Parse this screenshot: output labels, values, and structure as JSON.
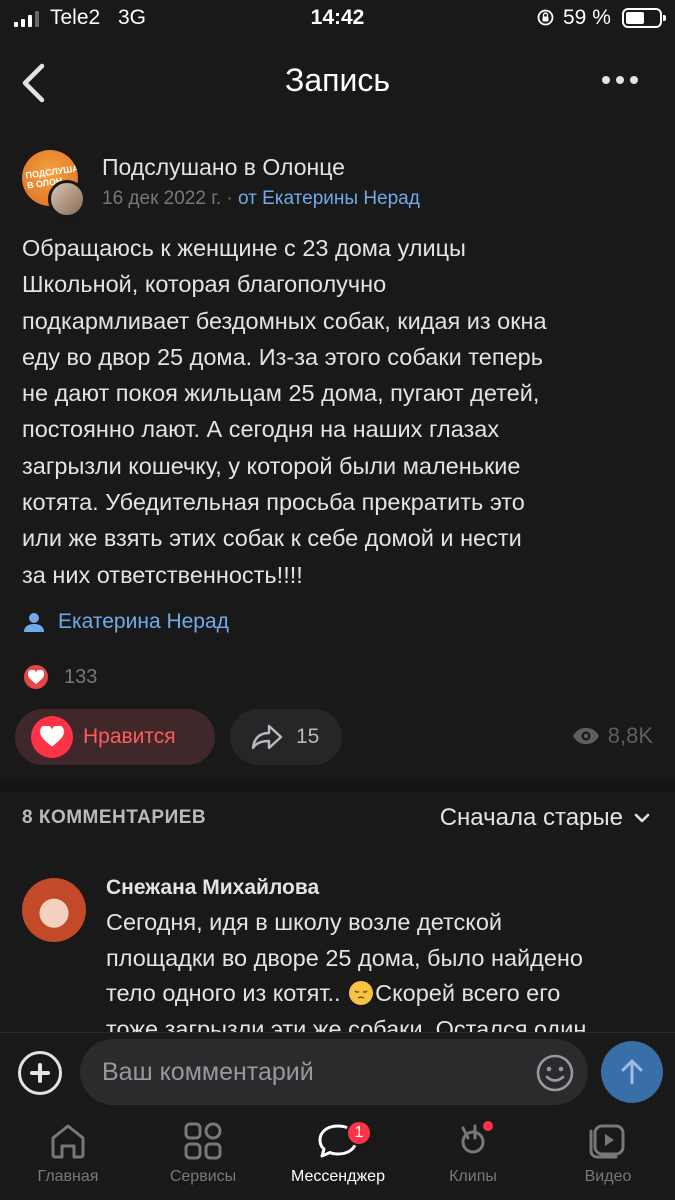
{
  "status_bar": {
    "carrier": "Tele2",
    "network": "3G",
    "time": "14:42",
    "battery_percent": "59 %",
    "battery_level": 0.59
  },
  "header": {
    "title": "Запись"
  },
  "post": {
    "group_name": "Подслушано в Олонце",
    "date": "16 дек 2022 г.",
    "separator": "·",
    "from_label": "от Екатерины Нерад",
    "text_lines": [
      "Обращаюсь к женщине с 23 дома улицы",
      "Школьной, которая благополучно",
      "подкармливает бездомных собак, кидая из окна",
      "еду во двор 25 дома. Из-за этого собаки теперь",
      "не дают покоя жильцам 25 дома, пугают детей,",
      "постоянно лают. А сегодня на наших глазах",
      "загрызли кошечку, у которой были маленькие",
      "котята. Убедительная просьба прекратить это",
      "или же взять этих собак к себе домой и нести",
      "за них ответственность!!!!"
    ],
    "signer": "Екатерина Нерад",
    "likes_count": "133",
    "like_button_label": "Нравится",
    "shares_count": "15",
    "views": "8,8K"
  },
  "comments": {
    "count_label": "8 КОММЕНТАРИЕВ",
    "sort_label": "Сначала старые",
    "items": [
      {
        "author": "Снежана Михайлова",
        "line1": "Сегодня, идя в школу возле детской",
        "line2": "площадки во дворе 25 дома, было найдено",
        "line3_a": "тело одного из котят..",
        "line3_b": "Скорей всего его",
        "line4": "тоже загрызли эти же собаки. Остался один"
      }
    ]
  },
  "input": {
    "placeholder": "Ваш комментарий"
  },
  "tab_bar": {
    "items": [
      {
        "label": "Главная",
        "icon": "home-icon"
      },
      {
        "label": "Сервисы",
        "icon": "services-icon"
      },
      {
        "label": "Мессенджер",
        "icon": "messenger-icon",
        "badge": "1",
        "active": true
      },
      {
        "label": "Клипы",
        "icon": "clips-icon",
        "dot": true
      },
      {
        "label": "Видео",
        "icon": "video-icon"
      }
    ]
  },
  "colors": {
    "background": "#191919",
    "accent_blue": "#71aaeb",
    "like_red": "#ff3347"
  }
}
